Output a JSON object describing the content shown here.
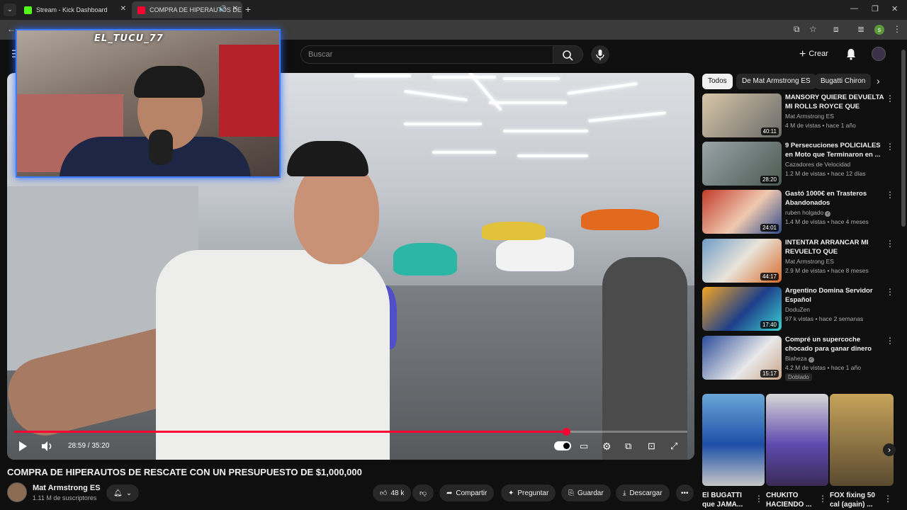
{
  "browser": {
    "tabs": [
      {
        "label": "Stream - Kick Dashboard",
        "favicon_color": "#53fc18"
      },
      {
        "label": "COMPRA DE HIPERAUTOS DE",
        "favicon_color": "#ff0033"
      }
    ]
  },
  "header": {
    "search_placeholder": "Buscar",
    "create_label": "Crear"
  },
  "webcam": {
    "streamer_label": "EL_TUCU_77"
  },
  "player": {
    "current_time": "28:59",
    "duration": "35:20",
    "time_display": "28:59 / 35:20",
    "progress_fraction": 0.8203,
    "accent_color": "#ff0033"
  },
  "video": {
    "title": "COMPRA DE HIPERAUTOS DE RESCATE CON UN PRESUPUESTO DE $1,000,000",
    "channel_name": "Mat Armstrong ES",
    "subscribers": "1.11 M de suscriptores",
    "likes": "48 k",
    "share_label": "Compartir",
    "ask_label": "Preguntar",
    "save_label": "Guardar",
    "download_label": "Descargar"
  },
  "sidebar": {
    "chips": [
      "Todos",
      "De Mat Armstrong ES",
      "Bugatti Chiron"
    ],
    "recommendations": [
      {
        "title": "MANSORY QUIERE DEVUELTA MI ROLLS ROYCE QUE ACABO ...",
        "channel": "Mat Armstrong ES",
        "meta": "4 M de vistas • hace 1 año",
        "duration": "40:11",
        "verified": false
      },
      {
        "title": "9 Persecuciones POLICIALES en Moto que Terminaron en ...",
        "channel": "Cazadores de Velocidad",
        "meta": "1.2 M de vistas • hace 12 días",
        "duration": "28:20",
        "verified": false
      },
      {
        "title": "Gastó 1000€ en Trasteros Abandonados",
        "channel": "ruben holgado",
        "meta": "1.4 M de vistas • hace 4 meses",
        "duration": "24:01",
        "verified": true
      },
      {
        "title": "INTENTAR ARRANCAR MI REVUELTO QUE LAMBORGHIN...",
        "channel": "Mat Armstrong ES",
        "meta": "2.9 M de vistas • hace 8 meses",
        "duration": "44:17",
        "verified": false
      },
      {
        "title": "Argentino Domina Servidor Español",
        "channel": "DoduZen",
        "meta": "97 k vistas • hace 2 semanas",
        "duration": "17:40",
        "verified": false
      },
      {
        "title": "Compré un supercoche chocado para ganar dinero",
        "channel": "Biaheza",
        "meta": "4.2 M de vistas • hace 1 año",
        "duration": "15:17",
        "verified": true,
        "badge": "Doblado"
      }
    ],
    "shorts": [
      {
        "title": "El BUGATTI que JAMA..."
      },
      {
        "title": "CHUKITO HACIENDO ..."
      },
      {
        "title": "FOX fixing 50 cal (again) ..."
      }
    ]
  }
}
